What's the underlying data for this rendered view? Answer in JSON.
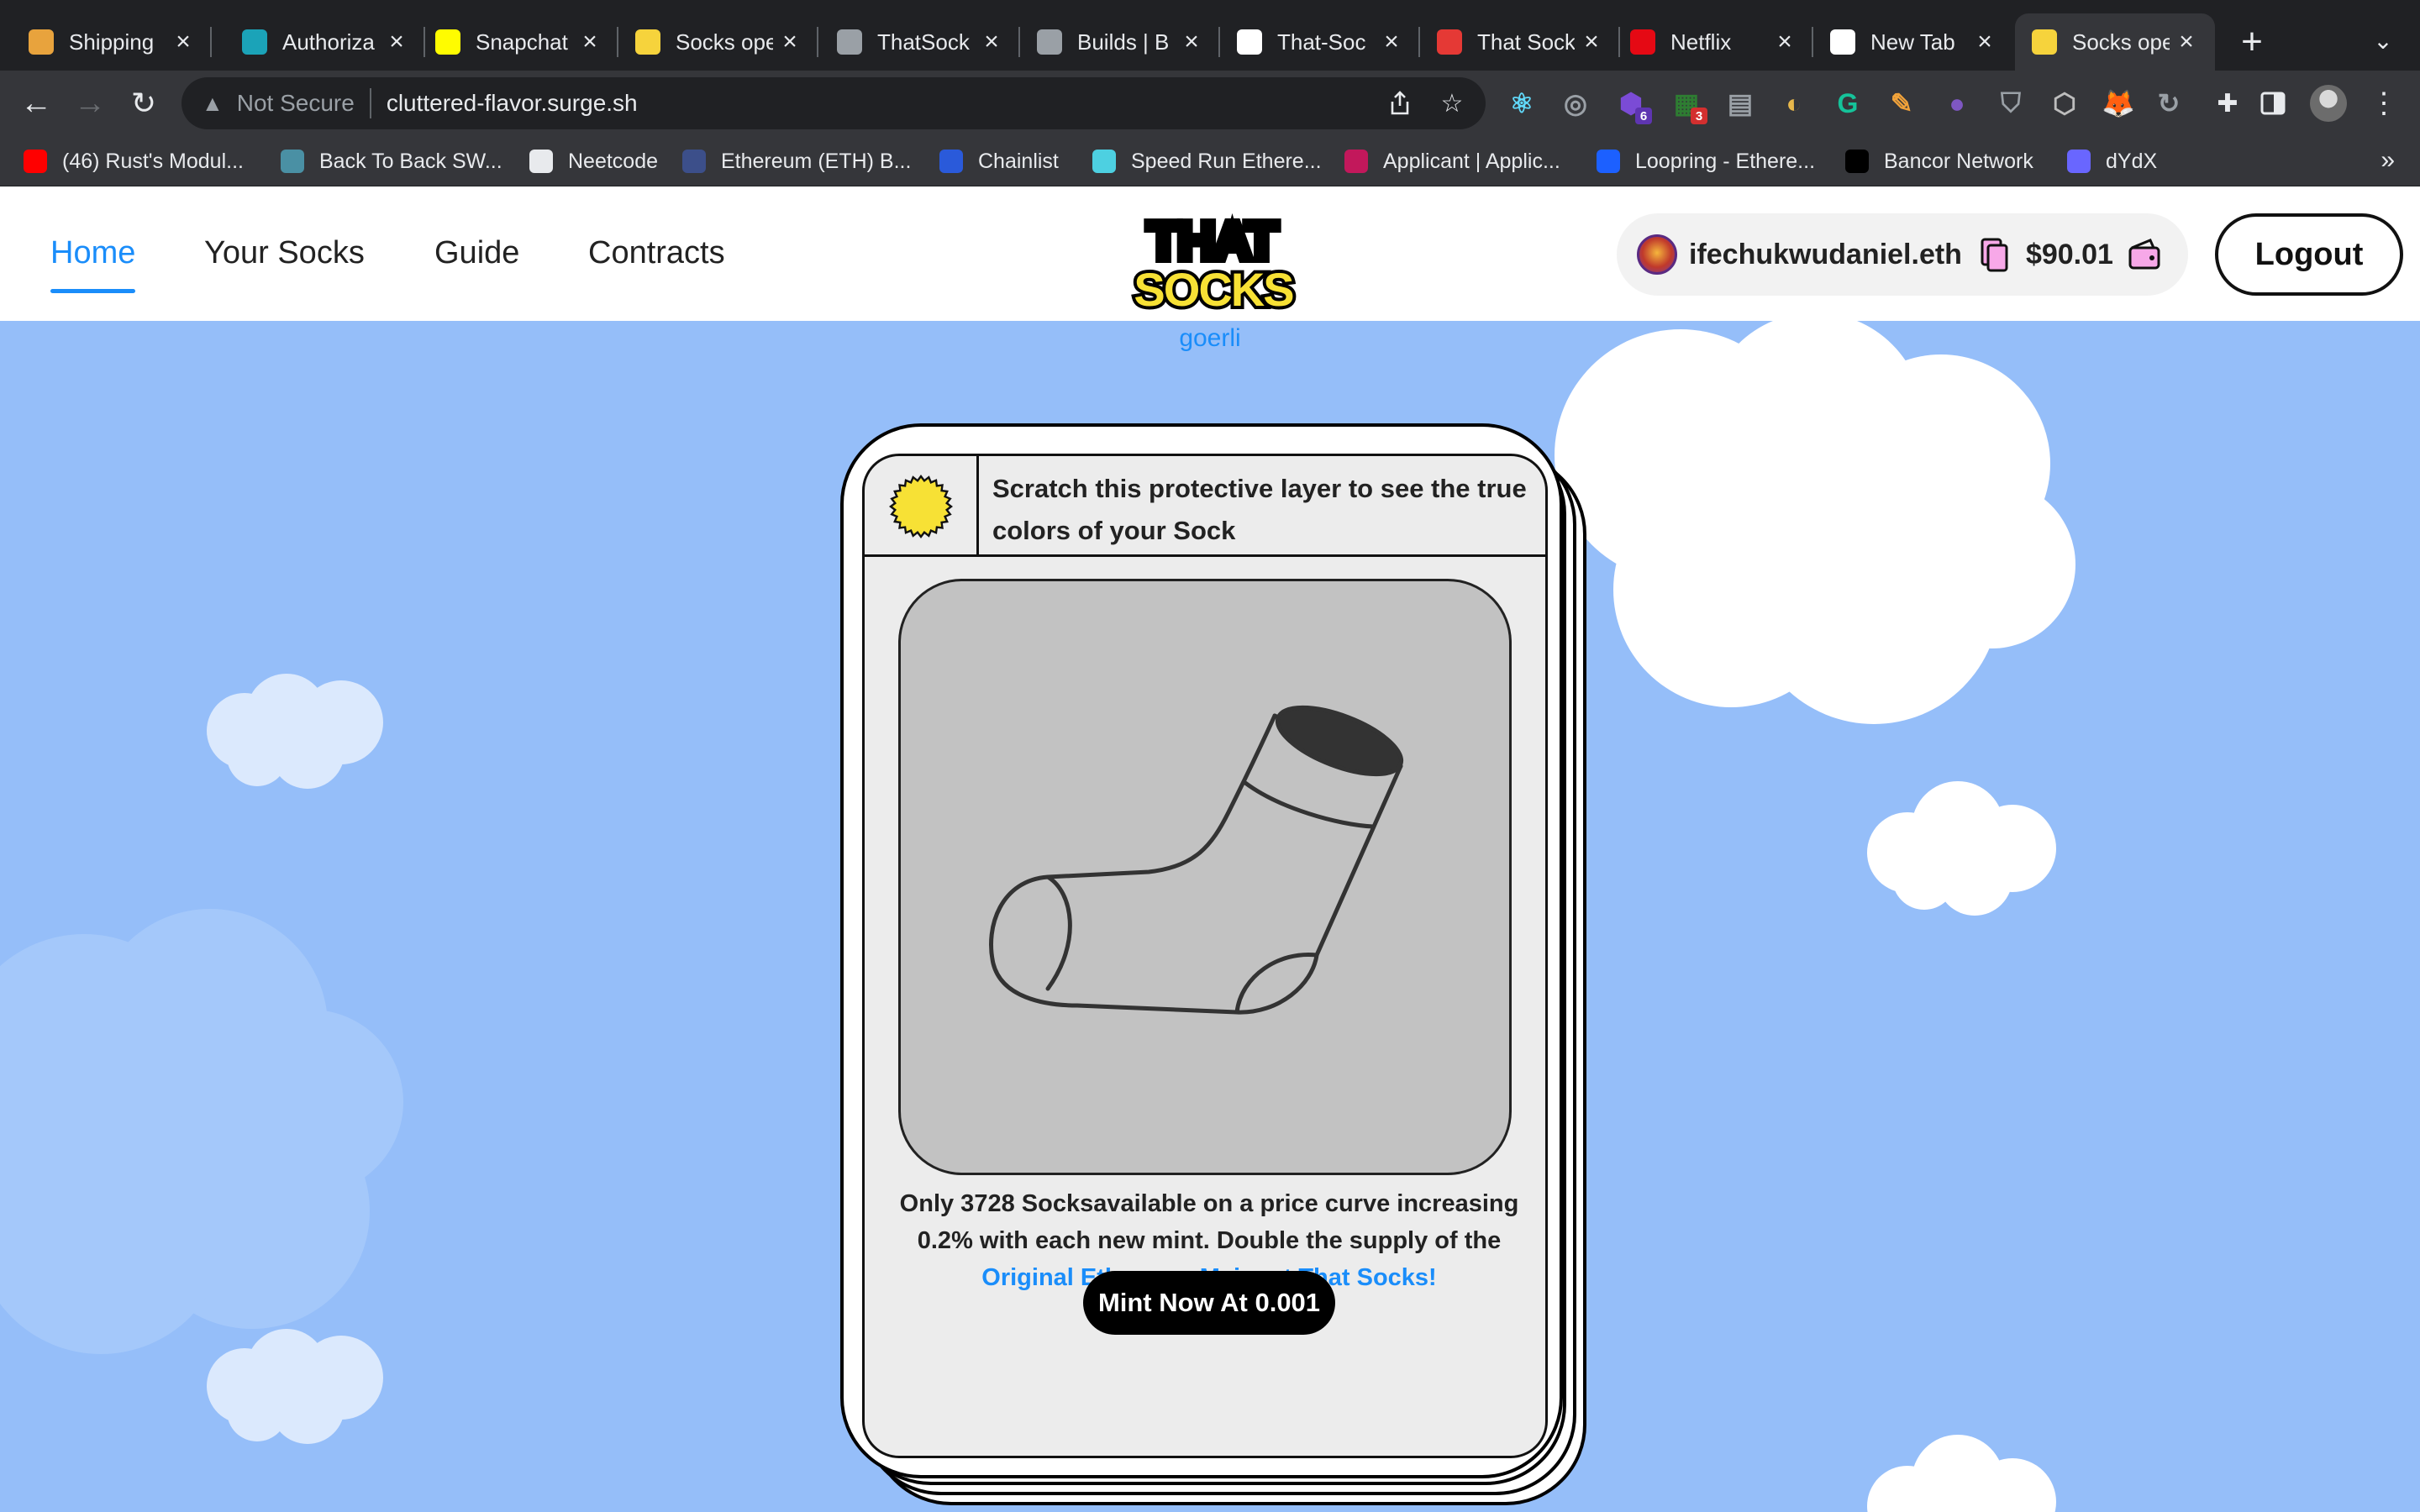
{
  "browser": {
    "tabs": [
      {
        "label": "Shipping",
        "icon": "crane-icon",
        "color": "#e8a33d"
      },
      {
        "label": "Authoriza",
        "icon": "diamond-icon",
        "color": "#1ba3b8"
      },
      {
        "label": "Snapchat",
        "icon": "snapchat-icon",
        "color": "#fffc00"
      },
      {
        "label": "Socks ope",
        "icon": "socks-icon",
        "color": "#f6d33c"
      },
      {
        "label": "ThatSock",
        "icon": "castle-icon",
        "color": "#9aa0a6"
      },
      {
        "label": "Builds | B",
        "icon": "castle-icon",
        "color": "#9aa0a6"
      },
      {
        "label": "That-Soc",
        "icon": "github-icon",
        "color": "#ffffff"
      },
      {
        "label": "That Sock",
        "icon": "sock-icon",
        "color": "#e53935"
      },
      {
        "label": "Netflix",
        "icon": "netflix-icon",
        "color": "#e50914"
      },
      {
        "label": "New Tab",
        "icon": "chrome-icon",
        "color": "#ffffff"
      },
      {
        "label": "Socks ope",
        "icon": "socks-icon",
        "color": "#f6d33c",
        "active": true
      }
    ],
    "new_tab_symbol": "+",
    "address": {
      "security_label": "Not Secure",
      "url": "cluttered-flavor.surge.sh"
    },
    "bookmarks": [
      {
        "label": "(46) Rust's Modul...",
        "icon": "youtube-icon",
        "color": "#ff0000"
      },
      {
        "label": "Back To Back SW...",
        "icon": "bookmark-icon",
        "color": "#4a90a4"
      },
      {
        "label": "Neetcode",
        "icon": "rocket-icon",
        "color": "#e8eaed"
      },
      {
        "label": "Ethereum (ETH) B...",
        "icon": "moon-icon",
        "color": "#3c4f8a"
      },
      {
        "label": "Chainlist",
        "icon": "chainlist-icon",
        "color": "#2a5ada"
      },
      {
        "label": "Speed Run Ethere...",
        "icon": "runner-icon",
        "color": "#4dd0e1"
      },
      {
        "label": "Applicant | Applic...",
        "icon": "applicant-icon",
        "color": "#c2185b"
      },
      {
        "label": "Loopring - Ethere...",
        "icon": "loopring-icon",
        "color": "#1c60ff"
      },
      {
        "label": "Bancor Network",
        "icon": "bancor-icon",
        "color": "#000000"
      },
      {
        "label": "dYdX",
        "icon": "dydx-icon",
        "color": "#6966ff"
      }
    ],
    "bookmarks_overflow": "»",
    "extension_badges": {
      "a": "6",
      "b": "3"
    }
  },
  "site": {
    "nav": [
      {
        "label": "Home",
        "active": true
      },
      {
        "label": "Your Socks"
      },
      {
        "label": "Guide"
      },
      {
        "label": "Contracts"
      }
    ],
    "logo": {
      "top": "THAT",
      "bottom": "SOCKS"
    },
    "account": {
      "ens": "ifechukwudaniel.eth",
      "balance": "$90.01"
    },
    "logout_label": "Logout",
    "network": "goerli",
    "card": {
      "header": "Scratch this protective layer to see the true colors of your Sock",
      "desc_prefix": "Only 3728 Socksavailable on a price curve increasing 0.2% with each new mint. Double the supply of the ",
      "desc_link": "Original Ethereum Mainnet That Socks!",
      "mint_label": "Mint Now At 0.001"
    },
    "colors": {
      "accent": "#1a8dfa",
      "sky": "#95bef9",
      "cloud": "#ffffff",
      "logo_yellow": "#f7e135"
    }
  }
}
